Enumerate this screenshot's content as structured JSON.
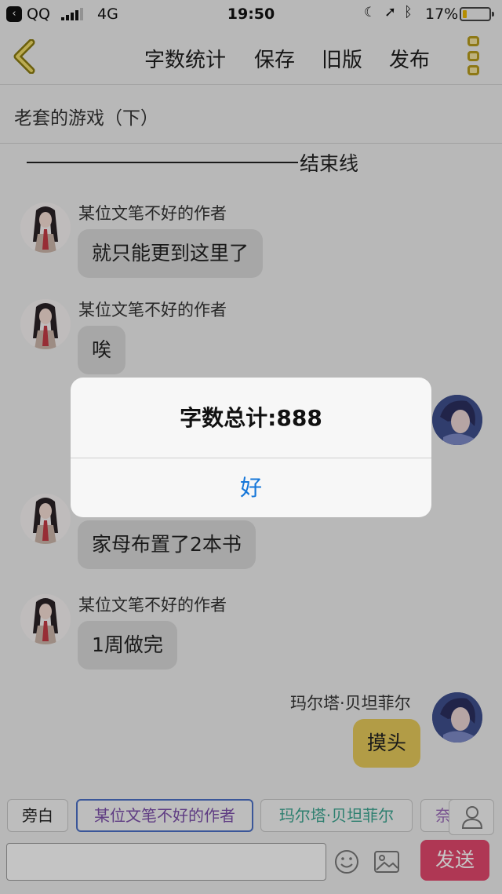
{
  "status_bar": {
    "carrier": "QQ",
    "network": "4G",
    "time": "19:50",
    "battery_percent": "17%",
    "battery_level": 0.17
  },
  "nav": {
    "word_count": "字数统计",
    "save": "保存",
    "old_version": "旧版",
    "publish": "发布"
  },
  "story_title": "老套的游戏（下）",
  "end_line_label": "结束线",
  "messages": [
    {
      "sender": "某位文笔不好的作者",
      "text": "就只能更到这里了"
    },
    {
      "sender": "某位文笔不好的作者",
      "text": "唉"
    },
    {
      "text": "家母布置了2本书"
    },
    {
      "sender": "某位文笔不好的作者",
      "text": "1周做完"
    },
    {
      "sender": "玛尔塔·贝坦菲尔",
      "text": "摸头"
    }
  ],
  "dialog": {
    "message": "字数总计:888",
    "ok": "好"
  },
  "roles": [
    "旁白",
    "某位文笔不好的作者",
    "玛尔塔·贝坦菲尔",
    "奈"
  ],
  "input": {
    "value": "",
    "placeholder": ""
  },
  "send_label": "发送",
  "colors": {
    "accent_gold": "#e4c85a",
    "send_pink": "#e0476c",
    "link_blue": "#1677d9"
  }
}
